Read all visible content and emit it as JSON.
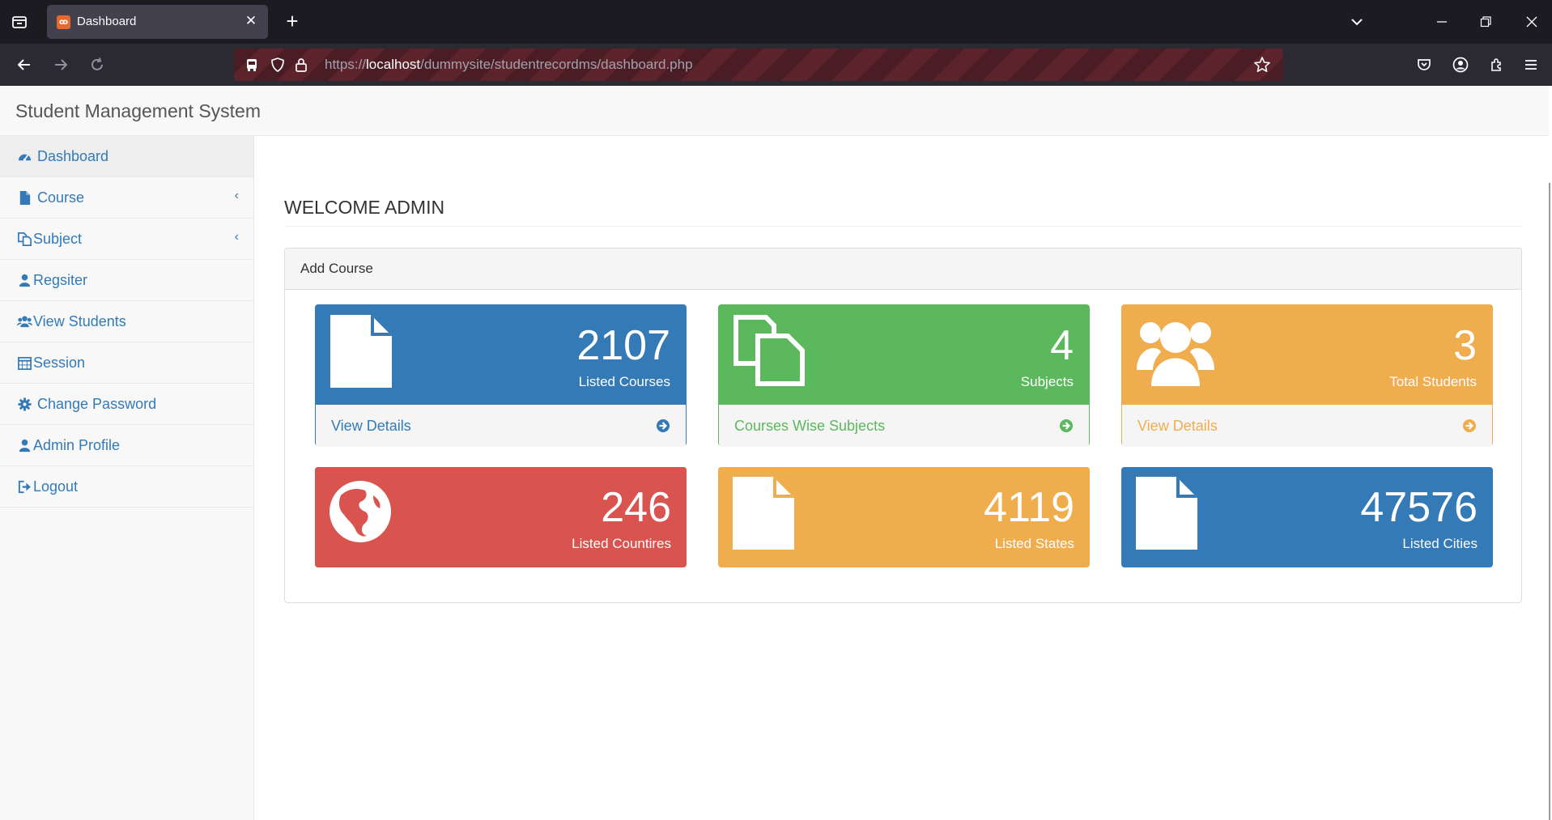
{
  "browser": {
    "tab_title": "Dashboard",
    "tab_favicon_text": "ꝏ",
    "close_glyph": "✕",
    "new_tab_glyph": "+",
    "url_scheme": "https://",
    "url_host": "localhost",
    "url_path": "/dummysite/studentrecordms/dashboard.php"
  },
  "app": {
    "brand": "Student Management System"
  },
  "sidebar": {
    "items": [
      {
        "label": "Dashboard",
        "icon": "dashboard-icon",
        "active": true
      },
      {
        "label": "Course",
        "icon": "file-icon",
        "has_submenu": true
      },
      {
        "label": "Subject",
        "icon": "copy-icon",
        "has_submenu": true
      },
      {
        "label": "Regsiter",
        "icon": "user-icon"
      },
      {
        "label": "View Students",
        "icon": "users-icon"
      },
      {
        "label": "Session",
        "icon": "calendar-icon"
      },
      {
        "label": "Change Password",
        "icon": "gear-icon"
      },
      {
        "label": "Admin Profile",
        "icon": "user-icon"
      },
      {
        "label": "Logout",
        "icon": "sign-out-icon"
      }
    ],
    "submenu_glyph": "‹"
  },
  "main": {
    "heading": "WELCOME ADMIN",
    "panel_title": "Add Course",
    "cards": [
      {
        "value": "2107",
        "label": "Listed Courses",
        "footer": "View Details",
        "color": "#337ab7",
        "icon": "file-icon"
      },
      {
        "value": "4",
        "label": "Subjects",
        "footer": "Courses Wise Subjects",
        "color": "#5cb85c",
        "icon": "copy-icon"
      },
      {
        "value": "3",
        "label": "Total Students",
        "footer": "View Details",
        "color": "#f0ad4e",
        "icon": "users-icon"
      },
      {
        "value": "246",
        "label": "Listed Countires",
        "color": "#d9534f",
        "icon": "globe-icon"
      },
      {
        "value": "4119",
        "label": "Listed States",
        "color": "#f0ad4e",
        "icon": "file-icon"
      },
      {
        "value": "47576",
        "label": "Listed Cities",
        "color": "#337ab7",
        "icon": "file-icon"
      }
    ]
  }
}
